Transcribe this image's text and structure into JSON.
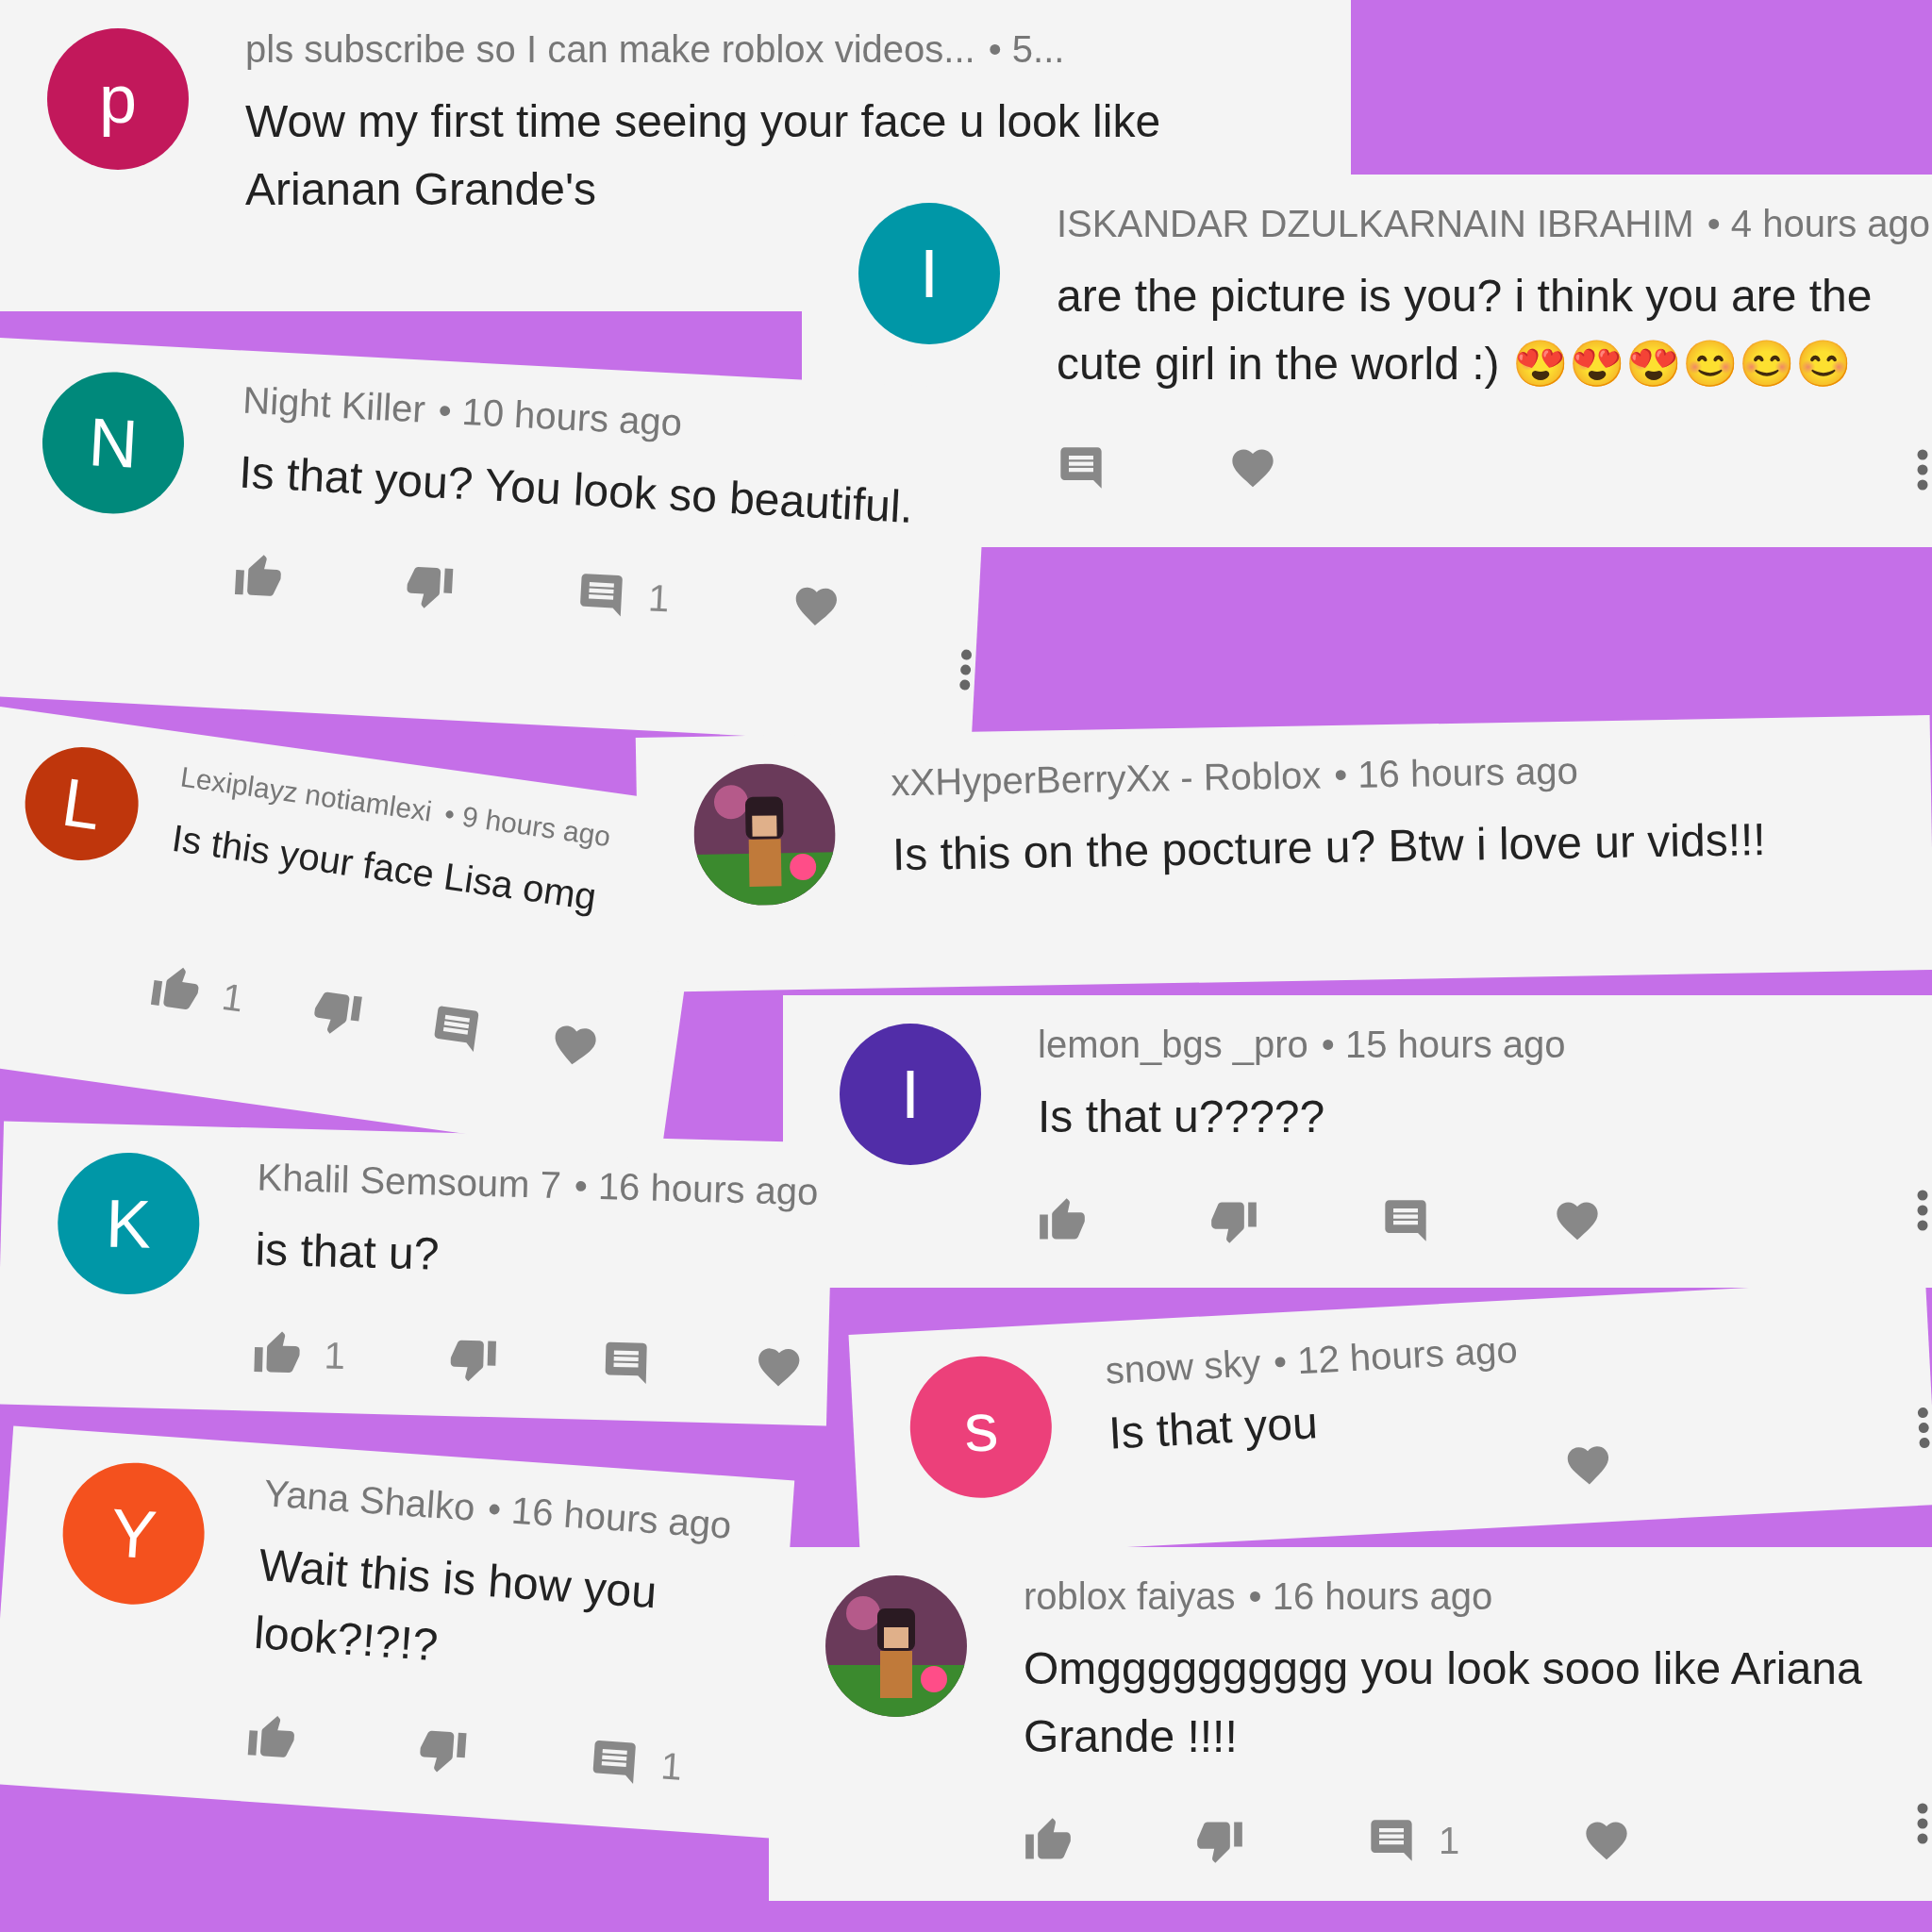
{
  "comments": [
    {
      "avatar": {
        "kind": "letter",
        "letter": "p",
        "color": "#c2185b"
      },
      "author": "pls subscribe so I can make roblox videos...",
      "time": "• 5...",
      "text": "Wow my first time seeing your face u look like Arianan Grande's"
    },
    {
      "avatar": {
        "kind": "letter",
        "letter": "I",
        "color": "#0097a7"
      },
      "author": "ISKANDAR DZULKARNAIN IBRAHIM",
      "time": "• 4 hours ago",
      "text": "are the picture is you? i think you are the cute girl in the world :) 😍😍😍😊😊😊",
      "actions": [
        {
          "kind": "reply"
        },
        {
          "kind": "heart"
        },
        {
          "kind": "more"
        }
      ]
    },
    {
      "avatar": {
        "kind": "letter",
        "letter": "N",
        "color": "#00897b"
      },
      "author": "Night Killer",
      "time": "• 10 hours ago",
      "text": "Is that you? You look so beautiful.",
      "actions": [
        {
          "kind": "like"
        },
        {
          "kind": "dislike"
        },
        {
          "kind": "reply",
          "count": "1"
        },
        {
          "kind": "heart"
        },
        {
          "kind": "more"
        }
      ]
    },
    {
      "author": "xXHyperBerryXx - Roblox",
      "time": "• 16 hours ago",
      "text": "Is this on the pocture u? Btw i love ur vids!!!"
    },
    {
      "avatar": {
        "kind": "letter",
        "letter": "L",
        "color": "#bf360c"
      },
      "author": "Lexiplayz notiamlexi",
      "time": "• 9 hours ago",
      "text": "Is this your face Lisa omg",
      "actions": [
        {
          "kind": "like",
          "count": "1"
        },
        {
          "kind": "dislike"
        },
        {
          "kind": "reply"
        },
        {
          "kind": "heart"
        }
      ]
    },
    {
      "avatar": {
        "kind": "letter",
        "letter": "I",
        "color": "#512da8"
      },
      "author": "lemon_bgs _pro",
      "time": "• 15 hours ago",
      "text": "Is that u?????",
      "actions": [
        {
          "kind": "like"
        },
        {
          "kind": "dislike"
        },
        {
          "kind": "reply"
        },
        {
          "kind": "heart"
        },
        {
          "kind": "more"
        }
      ]
    },
    {
      "avatar": {
        "kind": "letter",
        "letter": "K",
        "color": "#0097a7"
      },
      "author": "Khalil Semsoum 7",
      "time": "• 16 hours ago",
      "text": "is that u?",
      "actions": [
        {
          "kind": "like",
          "count": "1"
        },
        {
          "kind": "dislike"
        },
        {
          "kind": "reply"
        },
        {
          "kind": "heart"
        }
      ]
    },
    {
      "avatar": {
        "kind": "letter",
        "letter": "s",
        "color": "#ec407a"
      },
      "author": "snow sky",
      "time": "• 12 hours ago",
      "text": "Is that you",
      "actions": [
        {
          "kind": "heart"
        },
        {
          "kind": "more"
        }
      ]
    },
    {
      "avatar": {
        "kind": "letter",
        "letter": "Y",
        "color": "#f4511e"
      },
      "author": "Yana Shalko",
      "time": "• 16 hours ago",
      "text": "Wait this is how you look?!?!?",
      "actions": [
        {
          "kind": "like"
        },
        {
          "kind": "dislike"
        },
        {
          "kind": "reply",
          "count": "1"
        }
      ]
    },
    {
      "author": "roblox faiyas",
      "time": "• 16 hours ago",
      "text": "Omgggggggggg you look sooo like Ariana Grande !!!!",
      "actions": [
        {
          "kind": "like"
        },
        {
          "kind": "dislike"
        },
        {
          "kind": "reply",
          "count": "1"
        },
        {
          "kind": "heart"
        },
        {
          "kind": "more"
        }
      ]
    }
  ]
}
